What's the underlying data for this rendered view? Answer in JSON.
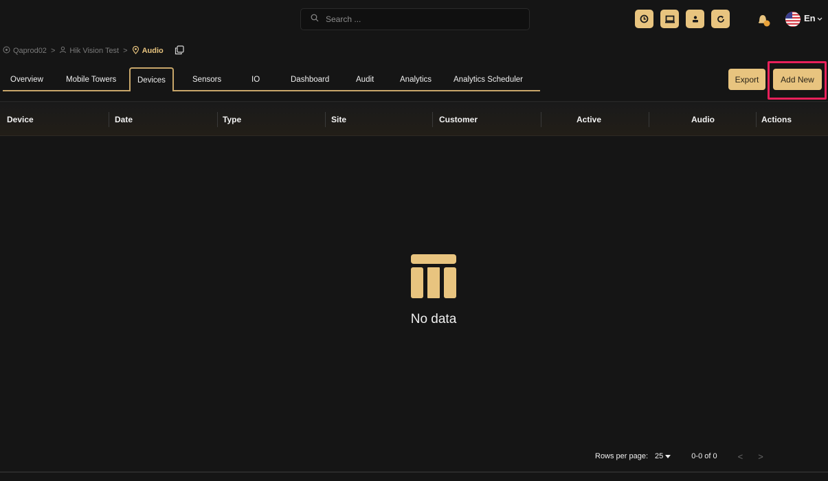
{
  "search": {
    "placeholder": "Search ..."
  },
  "header": {
    "language": "En",
    "icons": [
      "clock-icon",
      "monitor-icon",
      "user-icon",
      "refresh-icon"
    ]
  },
  "breadcrumb": {
    "items": [
      "Qaprod02",
      "Hik Vision Test",
      "Audio"
    ]
  },
  "tabs": [
    {
      "label": "Overview"
    },
    {
      "label": "Mobile Towers"
    },
    {
      "label": "Devices",
      "active": true
    },
    {
      "label": "Sensors"
    },
    {
      "label": "IO"
    },
    {
      "label": "Dashboard"
    },
    {
      "label": "Audit"
    },
    {
      "label": "Analytics"
    },
    {
      "label": "Analytics Scheduler"
    }
  ],
  "actions": {
    "export_label": "Export",
    "add_new_label": "Add New"
  },
  "table": {
    "columns": [
      "Device",
      "Date",
      "Type",
      "Site",
      "Customer",
      "Active",
      "Audio",
      "Actions"
    ],
    "empty_text": "No data"
  },
  "pagination": {
    "rows_per_page_label": "Rows per page:",
    "rows_per_page_value": "25",
    "range": "0-0 of 0",
    "prev": "<",
    "next": ">"
  },
  "colors": {
    "accent": "#e8c47f",
    "highlight": "#e8205a",
    "background": "#151515"
  }
}
